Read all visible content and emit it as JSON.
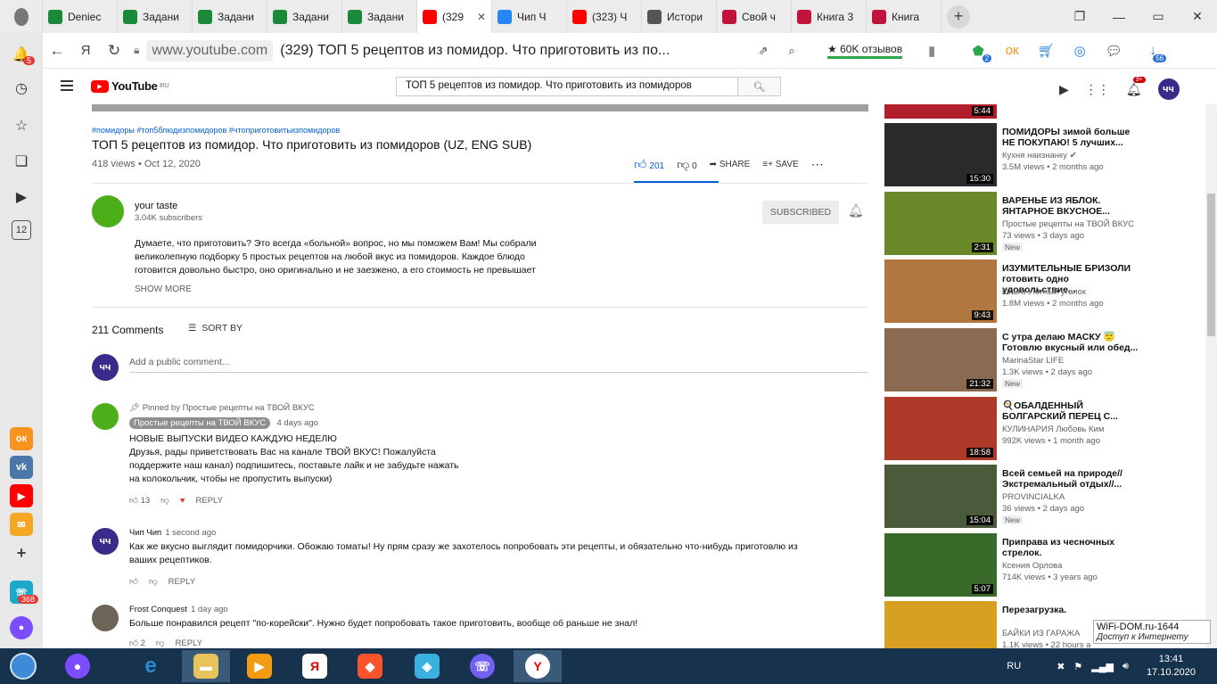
{
  "browser": {
    "tabs": [
      {
        "label": "Deniec",
        "icon": "green-app-icon",
        "color": "#1a8a3a"
      },
      {
        "label": "Задани",
        "icon": "green-app-icon",
        "color": "#1a8a3a"
      },
      {
        "label": "Задани",
        "icon": "green-app-icon",
        "color": "#1a8a3a"
      },
      {
        "label": "Задани",
        "icon": "green-app-icon",
        "color": "#1a8a3a"
      },
      {
        "label": "Задани",
        "icon": "green-app-icon",
        "color": "#1a8a3a"
      },
      {
        "label": "(329",
        "icon": "youtube-icon",
        "color": "#ff0000"
      },
      {
        "label": "Чип Ч",
        "icon": "vk-icon",
        "color": "#2787f5"
      },
      {
        "label": "(323) Ч",
        "icon": "youtube-icon",
        "color": "#ff0000"
      },
      {
        "label": "Истори",
        "icon": "clock-icon",
        "color": "#555555"
      },
      {
        "label": "Свой ч",
        "icon": "ruby-icon",
        "color": "#c0143c"
      },
      {
        "label": "Книга 3",
        "icon": "ruby-icon",
        "color": "#c0143c"
      },
      {
        "label": "Книга",
        "icon": "ruby-icon",
        "color": "#c0143c"
      }
    ],
    "active_tab_index": 5,
    "url_host": "www.youtube.com",
    "page_title": "(329) ТОП 5 рецептов из помидор. Что приготовить из по...",
    "reviews_label": "★ 60K отзывов",
    "ext_badges": {
      "shield": "2",
      "profile": "56"
    }
  },
  "browser_sidebar": {
    "badge": "5",
    "tab_count": "12",
    "viber_badge": "368"
  },
  "youtube": {
    "logo_text": "YouTube",
    "logo_region": "RU",
    "search_query": "ТОП 5 рецептов из помидор. Что приготовить из помидоров",
    "notif_badge": "9+",
    "avatar_text": "чч"
  },
  "video": {
    "tags": "#помидоры #топ5блюдизпомидоров #чтоприготовитьизпомидоров",
    "title": "ТОП 5 рецептов из помидор. Что приготовить из помидоров (UZ, ENG SUB)",
    "meta": "418 views • Oct 12, 2020",
    "likes": "201",
    "dislikes": "0",
    "share_label": "SHARE",
    "save_label": "SAVE"
  },
  "channel": {
    "name": "your taste",
    "subs": "3.04K subscribers",
    "subscribed_label": "SUBSCRIBED",
    "description": "Думаете, что приготовить?  Это всегда «больной» вопрос, но мы поможем Вам! Мы собрали великолепную подборку 5 простых рецептов на любой вкус из помидоров. Каждое блюдо готовится довольно быстро, оно оригинально и не заезжено, а его стоимость не превышает",
    "show_more": "SHOW MORE"
  },
  "comments": {
    "count_label": "211 Comments",
    "sort_label": "SORT BY",
    "add_placeholder": "Add a public comment...",
    "items": [
      {
        "pinned": "Pinned by Простые рецепты на ТВОЙ ВКУС",
        "author": "Простые рецепты на ТВОЙ ВКУС",
        "ago": "4 days ago",
        "heading": "НОВЫЕ ВЫПУСКИ ВИДЕО КАЖДУЮ НЕДЕЛЮ",
        "text": "Друзья, рады приветствовать Вас на канале ТВОЙ ВКУС! Пожалуйста\nподдержите наш канал)  подпишитесь, поставьте лайк и не забудьте нажать\nна колокольчик, чтобы не пропустить выпуски)",
        "likes": "13",
        "reply": "REPLY"
      },
      {
        "author": "Чип Чип",
        "ago": "1 second ago",
        "text": "Как же вкусно выглядит помидорчики. Обожаю томаты! Ну прям сразу же захотелось попробовать эти рецепты, и обязательно что-нибудь приготовлю из\nваших рецептиков.",
        "likes": "",
        "reply": "REPLY"
      },
      {
        "author": "Frost Conquest",
        "ago": "1 day ago",
        "text": "Больше понравился рецепт \"по-корейски\". Нужно будет попробовать такое приготовить, вообще об раньше не знал!",
        "likes": "2",
        "reply": "REPLY"
      }
    ]
  },
  "recommendations": [
    {
      "title": "",
      "channel": "",
      "meta": "",
      "duration": "5:44",
      "new": ""
    },
    {
      "title": "ПОМИДОРЫ зимой больше НЕ ПОКУПАЮ! 5 лучших...",
      "channel": "Кухня наизнанку ✔",
      "meta": "3.5M views • 2 months ago",
      "duration": "15:30",
      "new": ""
    },
    {
      "title": "ВАРЕНЬЕ ИЗ ЯБЛОК. ЯНТАРНОЕ ВКУСНОЕ...",
      "channel": "Простые рецепты на ТВОЙ ВКУС",
      "meta": "73 views • 3 days ago",
      "duration": "2:31",
      "new": "New"
    },
    {
      "title": "ИЗУМИТЕЛЬНЫЕ БРИЗОЛИ готовить одно удовольствие...",
      "channel": "Ольга Уютный уголок",
      "meta": "1.8M views • 2 months ago",
      "duration": "9:43",
      "new": ""
    },
    {
      "title": "С утра делаю МАСКУ 😇 Готовлю вкусный или обед...",
      "channel": "MarinaStar LIFE",
      "meta": "1.3K views • 2 days ago",
      "duration": "21:32",
      "new": "New"
    },
    {
      "title": "🍳ОБАЛДЕННЫЙ БОЛГАРСКИЙ ПЕРЕЦ С...",
      "channel": "КУЛИНАРИЯ Любовь Ким",
      "meta": "992K views • 1 month ago",
      "duration": "18:58",
      "new": ""
    },
    {
      "title": "Всей семьей на природе// Экстремальный отдых//...",
      "channel": "PROVINCIALKA",
      "meta": "36 views • 2 days ago",
      "duration": "15:04",
      "new": "New"
    },
    {
      "title": "Приправа из чесночных стрелок.",
      "channel": "Ксения Орлова",
      "meta": "714K views • 3 years ago",
      "duration": "5:07",
      "new": ""
    },
    {
      "title": "Перезагрузка.",
      "channel": "БАЙКИ ИЗ ГАРАЖА",
      "meta": "1.1K views • 22 hours a",
      "duration": "",
      "new": "New"
    }
  ],
  "watermark": {
    "line1": "WiFi-DOM.ru-1644",
    "line2": "Доступ к Интернету"
  },
  "taskbar": {
    "lang": "RU",
    "time": "13:41",
    "date": "17.10.2020"
  }
}
